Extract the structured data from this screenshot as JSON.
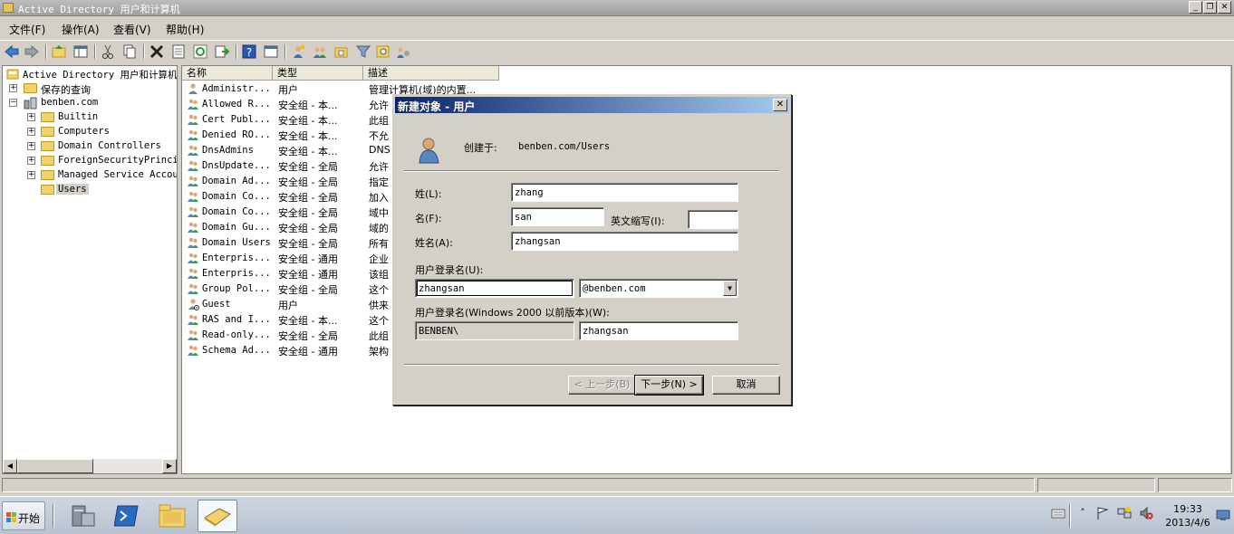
{
  "window": {
    "title": "Active Directory 用户和计算机",
    "buttons": {
      "minimize": "_",
      "restore": "❐",
      "close": "✕"
    }
  },
  "menubar": [
    "文件(F)",
    "操作(A)",
    "查看(V)",
    "帮助(H)"
  ],
  "toolbar": {
    "icons": [
      "back-arrow-icon",
      "forward-arrow-icon",
      "up-folder-icon",
      "show-console-tree-icon",
      "cut-icon",
      "copy-icon",
      "delete-icon",
      "properties-icon",
      "refresh-icon",
      "export-icon",
      "help-icon",
      "console-view-icon",
      "new-user-icon",
      "new-group-icon",
      "new-ou-icon",
      "filter-icon",
      "find-icon",
      "add-to-group-icon"
    ]
  },
  "tree": {
    "root": "Active Directory 用户和计算机",
    "saved_queries": "保存的查询",
    "domain": "benben.com",
    "children": [
      "Builtin",
      "Computers",
      "Domain Controllers",
      "ForeignSecurityPrincip",
      "Managed Service Accour",
      "Users"
    ],
    "selected": "Users"
  },
  "list": {
    "columns": [
      "名称",
      "类型",
      "描述"
    ],
    "rows": [
      {
        "name": "Administr...",
        "type": "用户",
        "desc": "管理计算机(域)的内置...",
        "kind": "user"
      },
      {
        "name": "Allowed R...",
        "type": "安全组 - 本...",
        "desc": "允许",
        "kind": "group"
      },
      {
        "name": "Cert Publ...",
        "type": "安全组 - 本...",
        "desc": "此组",
        "kind": "group"
      },
      {
        "name": "Denied RO...",
        "type": "安全组 - 本...",
        "desc": "不允",
        "kind": "group"
      },
      {
        "name": "DnsAdmins",
        "type": "安全组 - 本...",
        "desc": "DNS A",
        "kind": "group"
      },
      {
        "name": "DnsUpdate...",
        "type": "安全组 - 全局",
        "desc": "允许",
        "kind": "group"
      },
      {
        "name": "Domain Ad...",
        "type": "安全组 - 全局",
        "desc": "指定",
        "kind": "group"
      },
      {
        "name": "Domain Co...",
        "type": "安全组 - 全局",
        "desc": "加入",
        "kind": "group"
      },
      {
        "name": "Domain Co...",
        "type": "安全组 - 全局",
        "desc": "域中",
        "kind": "group"
      },
      {
        "name": "Domain Gu...",
        "type": "安全组 - 全局",
        "desc": "域的",
        "kind": "group"
      },
      {
        "name": "Domain Users",
        "type": "安全组 - 全局",
        "desc": "所有",
        "kind": "group"
      },
      {
        "name": "Enterpris...",
        "type": "安全组 - 通用",
        "desc": "企业",
        "kind": "group"
      },
      {
        "name": "Enterpris...",
        "type": "安全组 - 通用",
        "desc": "该组",
        "kind": "group"
      },
      {
        "name": "Group Pol...",
        "type": "安全组 - 全局",
        "desc": "这个",
        "kind": "group"
      },
      {
        "name": "Guest",
        "type": "用户",
        "desc": "供来",
        "kind": "user-disabled"
      },
      {
        "name": "RAS and I...",
        "type": "安全组 - 本...",
        "desc": "这个",
        "kind": "group"
      },
      {
        "name": "Read-only...",
        "type": "安全组 - 全局",
        "desc": "此组",
        "kind": "group"
      },
      {
        "name": "Schema Ad...",
        "type": "安全组 - 通用",
        "desc": "架构",
        "kind": "group"
      }
    ]
  },
  "dialog": {
    "title": "新建对象 - 用户",
    "created_in_label": "创建于:",
    "created_in_value": "benben.com/Users",
    "last_name_label": "姓(L):",
    "last_name_value": "zhang",
    "first_name_label": "名(F):",
    "first_name_value": "san",
    "initials_label": "英文缩写(I):",
    "initials_value": "",
    "full_name_label": "姓名(A):",
    "full_name_value": "zhangsan",
    "logon_name_label": "用户登录名(U):",
    "logon_name_value": "zhangsan",
    "upn_suffix_value": "@benben.com",
    "pre2000_label": "用户登录名(Windows 2000 以前版本)(W):",
    "pre2000_domain_value": "BENBEN\\",
    "pre2000_name_value": "zhangsan",
    "back_button": "< 上一步(B)",
    "next_button": "下一步(N) >",
    "cancel_button": "取消"
  },
  "taskbar": {
    "start_label": "开始",
    "tasks": [
      "server-manager-icon",
      "powershell-icon",
      "explorer-icon",
      "ad-users-computers-icon"
    ],
    "clock_time": "19:33",
    "clock_date": "2013/4/6"
  },
  "colors": {
    "dialog_title_start": "#0a246a",
    "dialog_title_end": "#a6caf0",
    "window_face": "#d4d0c8"
  }
}
